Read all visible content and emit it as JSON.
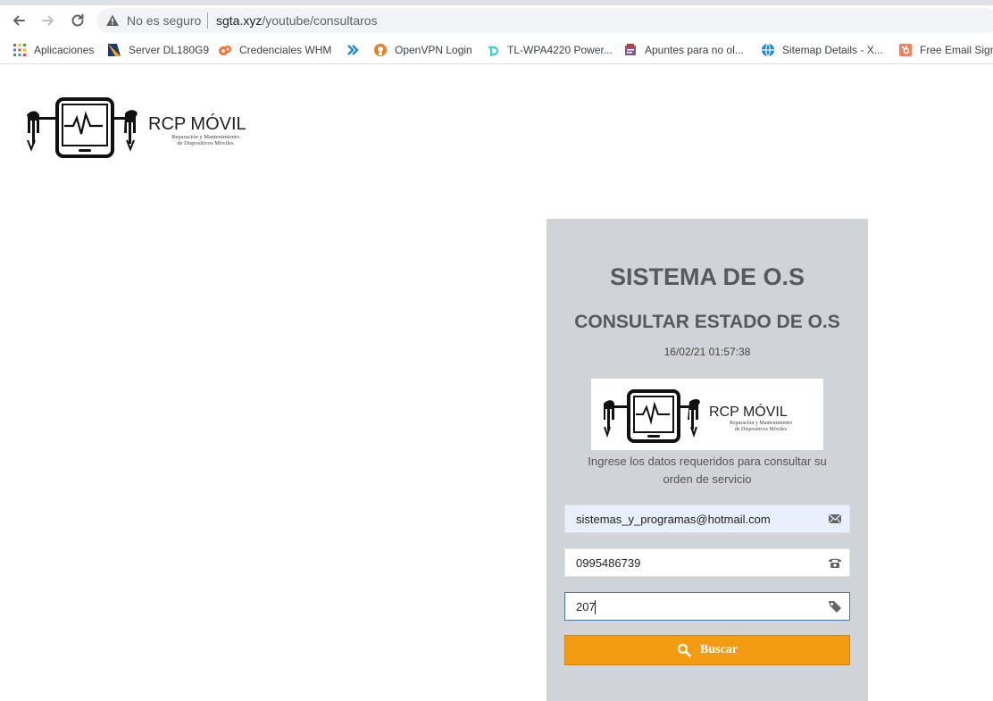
{
  "browser": {
    "security_label": "No es seguro",
    "url_host": "sgta.xyz",
    "url_path": "/youtube/consultaros",
    "bookmarks": [
      {
        "label": "Aplicaciones",
        "icon": "apps-grid-icon"
      },
      {
        "label": "Server DL180G9",
        "icon": "server-icon"
      },
      {
        "label": "Credenciales WHM",
        "icon": "cpanel-icon"
      },
      {
        "label": "",
        "icon": "arrow-right-icon"
      },
      {
        "label": "OpenVPN Login",
        "icon": "openvpn-icon"
      },
      {
        "label": "TL-WPA4220 Power...",
        "icon": "tplink-icon"
      },
      {
        "label": "Apuntes para no ol...",
        "icon": "notes-icon"
      },
      {
        "label": "Sitemap Details - X...",
        "icon": "globe-icon"
      },
      {
        "label": "Free Email Signa",
        "icon": "hubspot-icon"
      }
    ]
  },
  "header": {
    "logo_text": "RCP MÓVIL",
    "logo_tagline_line1": "Reparación y Mantenimiento",
    "logo_tagline_line2": "de Dispositivos Móviles"
  },
  "panel": {
    "title": "SISTEMA DE O.S",
    "subtitle": "CONSULTAR ESTADO DE O.S",
    "datetime": "16/02/21 01:57:38",
    "instructions": "Ingrese los datos requeridos para consultar su orden de servicio",
    "email_value": "sistemas_y_programas@hotmail.com",
    "phone_value": "0995486739",
    "order_value": "207",
    "search_label": "Buscar"
  },
  "colors": {
    "panel_bg": "#d0d3d8",
    "accent_button": "#f39c12",
    "heading_text": "#555a5f",
    "autofill_bg": "#e8f0fe"
  }
}
